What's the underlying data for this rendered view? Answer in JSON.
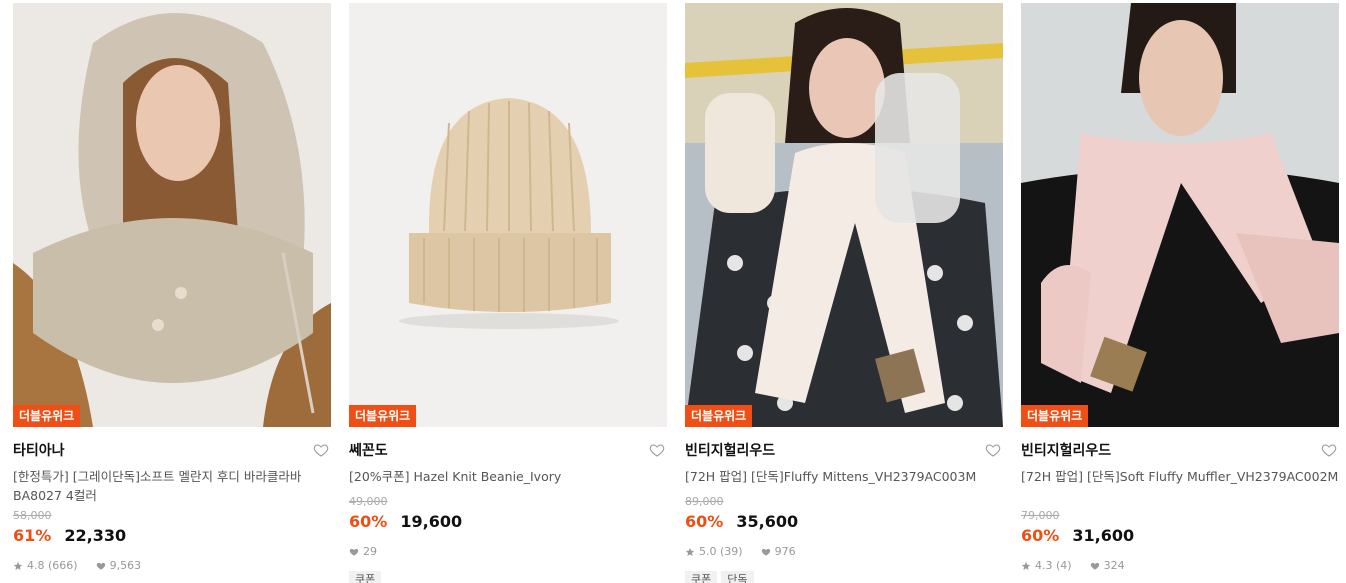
{
  "colors": {
    "accent": "#f04e14",
    "text": "#111111",
    "muted": "#999999"
  },
  "products": [
    {
      "badge": "더블유위크",
      "brand": "타티아나",
      "title": "[한정특가] [그레이단독]소프트 멜란지 후디 바라클라바 BA8027 4컬러",
      "original_price": "58,000",
      "discount": "61%",
      "price": "22,330",
      "rating": "4.8 (666)",
      "likes": "9,563",
      "tags": [],
      "heart_icon": "heart-outline-icon"
    },
    {
      "badge": "더블유위크",
      "brand": "쎄꼰도",
      "title": "[20%쿠폰] Hazel Knit Beanie_Ivory",
      "original_price": "49,000",
      "discount": "60%",
      "price": "19,600",
      "rating": "",
      "likes": "29",
      "tags": [
        "쿠폰"
      ],
      "heart_icon": "heart-outline-icon"
    },
    {
      "badge": "더블유위크",
      "brand": "빈티지헐리우드",
      "title": "[72H 팝업] [단독]Fluffy Mittens_VH2379AC003M",
      "original_price": "89,000",
      "discount": "60%",
      "price": "35,600",
      "rating": "5.0 (39)",
      "likes": "976",
      "tags": [
        "쿠폰",
        "단독"
      ],
      "heart_icon": "heart-outline-icon"
    },
    {
      "badge": "더블유위크",
      "brand": "빈티지헐리우드",
      "title": "[72H 팝업] [단독]Soft Fluffy Muffler_VH2379AC002M",
      "original_price": "79,000",
      "discount": "60%",
      "price": "31,600",
      "rating": "4.3 (4)",
      "likes": "324",
      "tags": [],
      "heart_icon": "heart-outline-icon"
    }
  ]
}
